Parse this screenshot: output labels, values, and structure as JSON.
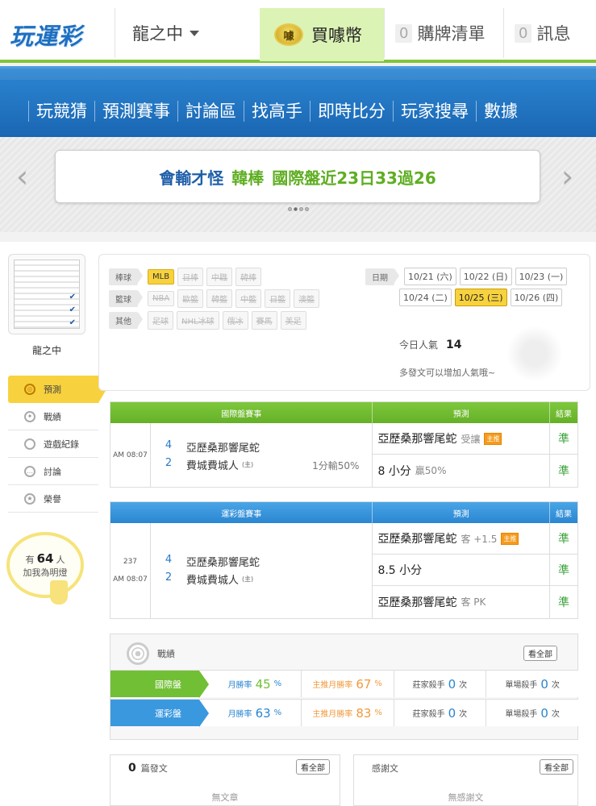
{
  "header": {
    "logo_text": "玩運彩",
    "user_menu": "龍之中",
    "buy_coin": "買噱幣",
    "coin_glyph": "噱",
    "cart_count": "0",
    "cart_label": "購牌清單",
    "msg_count": "0",
    "msg_label": "訊息"
  },
  "nav": [
    "玩競猜",
    "預測賽事",
    "討論區",
    "找高手",
    "即時比分",
    "玩家搜尋",
    "數據"
  ],
  "banner": {
    "part1": "會輸才怪",
    "part2": "韓棒",
    "part3": "國際盤近23日33過26",
    "prev": "‹",
    "next": "›"
  },
  "profile": {
    "username": "龍之中",
    "menu": [
      {
        "label": "預測",
        "icon": "target-icon"
      },
      {
        "label": "戰績",
        "icon": "medal-icon"
      },
      {
        "label": "遊戲紀錄",
        "icon": "ring-icon"
      },
      {
        "label": "討論",
        "icon": "chat-icon"
      },
      {
        "label": "榮譽",
        "icon": "trophy-icon"
      }
    ],
    "fans_prefix": "有",
    "fans_count": "64",
    "fans_unit": "人",
    "fans_tip": "加我為明燈"
  },
  "filter": {
    "baseball_tag": "棒球",
    "baseball": [
      "MLB",
      "日棒",
      "中職",
      "韓棒"
    ],
    "basketball_tag": "籃球",
    "basketball": [
      "NBA",
      "歐籃",
      "韓籃",
      "中籃",
      "日籃",
      "澳籃"
    ],
    "other_tag": "其他",
    "other": [
      "足球",
      "NHL冰球",
      "俄冰",
      "賽馬",
      "美足"
    ],
    "date_tag": "日期",
    "dates_row1": [
      "10/21 (六)",
      "10/22 (日)",
      "10/23 (一)"
    ],
    "dates_row2": [
      "10/24 (二)",
      "10/25 (三)",
      "10/26 (四)"
    ],
    "popularity_label": "今日人氣",
    "popularity_value": "14",
    "popularity_tip": "多發文可以增加人氣哦~"
  },
  "intl_table": {
    "h_game": "國際盤賽事",
    "h_pred": "預測",
    "h_res": "結果",
    "time": "AM 08:07",
    "away_score": "4",
    "away_team": "亞歷桑那響尾蛇",
    "home_score": "2",
    "home_team": "費城費城人",
    "host_mark": "(主)",
    "odds": "1分輸50%",
    "preds": [
      {
        "main": "亞歷桑那響尾蛇",
        "sub": "受讓",
        "badge": "主推",
        "res": "準"
      },
      {
        "main": "8 小分",
        "sub": "贏50%",
        "badge": "",
        "res": "準"
      }
    ]
  },
  "lottery_table": {
    "h_game": "運彩盤賽事",
    "h_pred": "預測",
    "h_res": "結果",
    "game_no": "237",
    "time": "AM 08:07",
    "away_score": "4",
    "away_team": "亞歷桑那響尾蛇",
    "home_score": "2",
    "home_team": "費城費城人",
    "host_mark": "(主)",
    "preds": [
      {
        "main": "亞歷桑那響尾蛇",
        "sub": "客 +1.5",
        "badge": "主推",
        "res": "準"
      },
      {
        "main": "8.5 小分",
        "sub": "",
        "badge": "",
        "res": "準"
      },
      {
        "main": "亞歷桑那響尾蛇",
        "sub": "客 PK",
        "badge": "",
        "res": "準"
      }
    ]
  },
  "stats": {
    "title": "戰績",
    "see_all": "看全部",
    "rows": [
      {
        "label": "國際盤",
        "m_label": "月勝率",
        "m_val": "45",
        "p_label": "主推月勝率",
        "p_val": "67",
        "pct": "%",
        "k1_label": "莊家殺手",
        "k1_val": "0",
        "k2_label": "單場殺手",
        "k2_val": "0",
        "unit": "次"
      },
      {
        "label": "運彩盤",
        "m_label": "月勝率",
        "m_val": "63",
        "p_label": "主推月勝率",
        "p_val": "83",
        "pct": "%",
        "k1_label": "莊家殺手",
        "k1_val": "0",
        "k2_label": "單場殺手",
        "k2_val": "0",
        "unit": "次"
      }
    ]
  },
  "posts": {
    "count": "0",
    "label": "篇發文",
    "see_all": "看全部",
    "empty": "無文章"
  },
  "thanks": {
    "label": "感謝文",
    "see_all": "看全部",
    "empty": "無感謝文"
  },
  "colors": {
    "accent_green": "#7ec63a",
    "nav_blue": "#1a66b3",
    "highlight": "#f7d23e",
    "result_green": "#3aa13a"
  }
}
